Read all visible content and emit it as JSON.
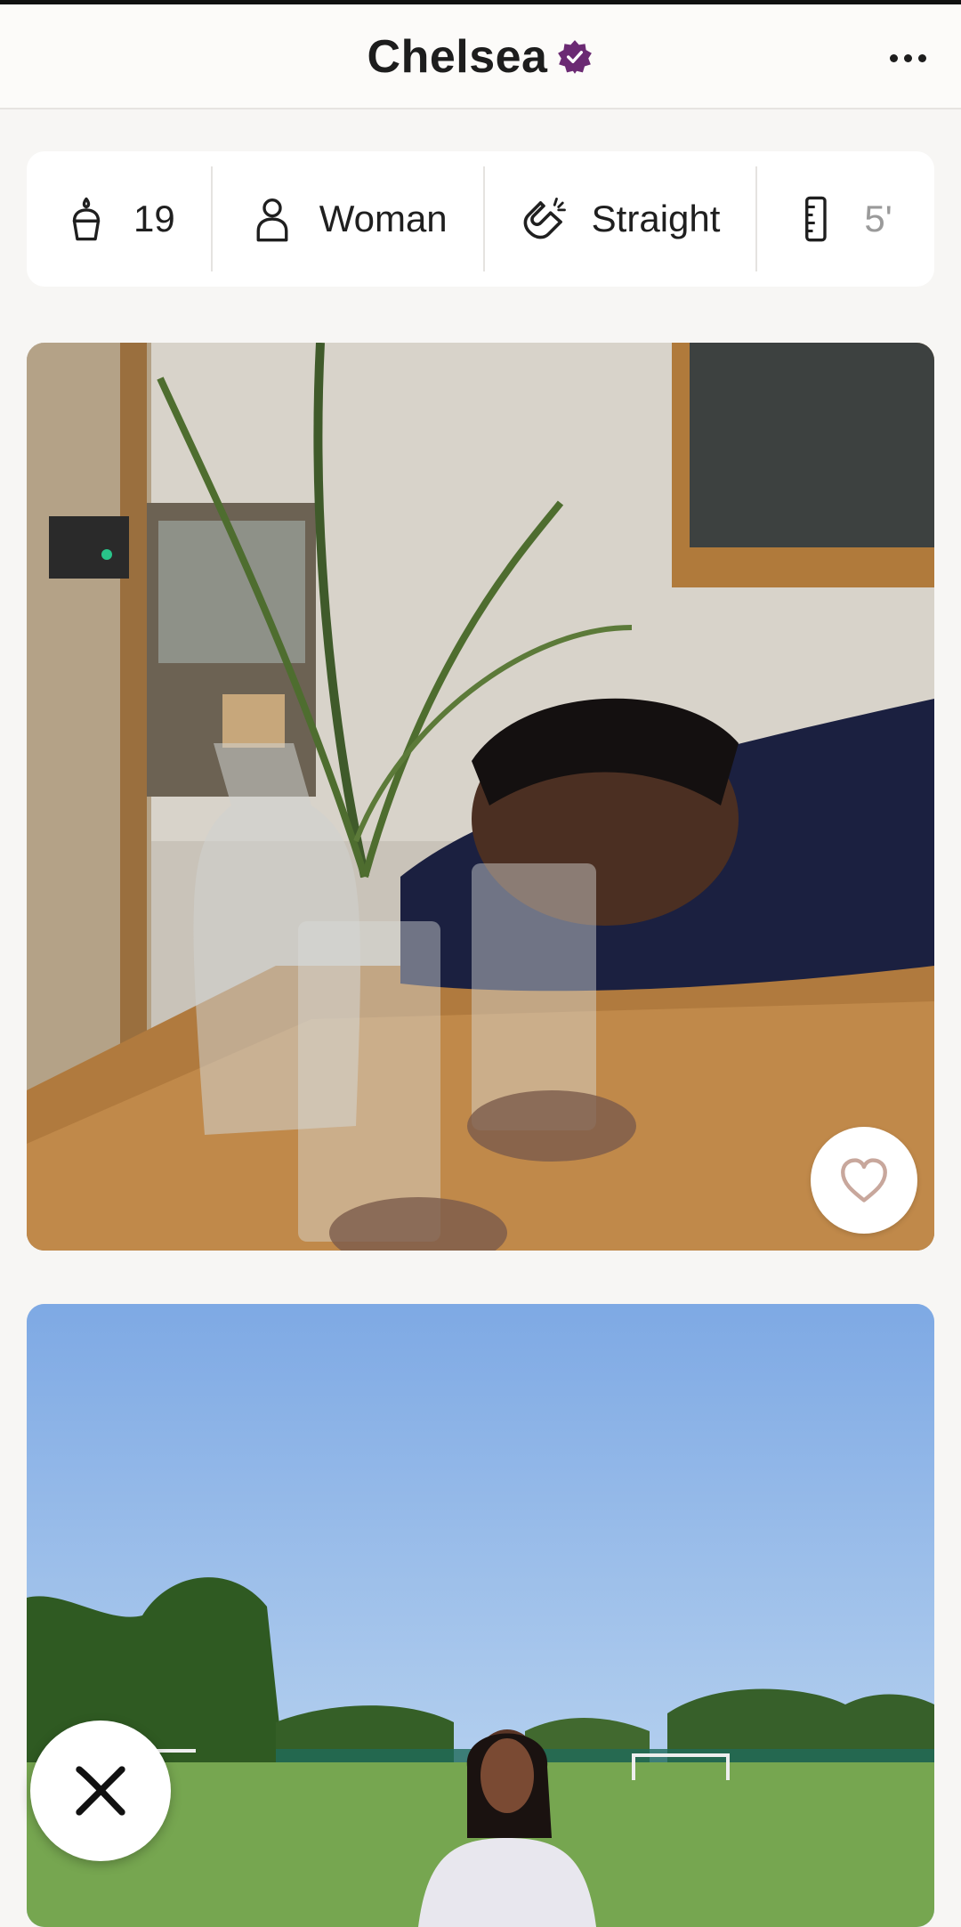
{
  "header": {
    "name": "Chelsea",
    "verified_icon": "verified-badge-icon",
    "more_icon": "more-options-icon"
  },
  "info": [
    {
      "icon": "birthday-cake-icon",
      "label": "19"
    },
    {
      "icon": "person-icon",
      "label": "Woman"
    },
    {
      "icon": "magnet-icon",
      "label": "Straight"
    },
    {
      "icon": "ruler-icon",
      "label": "5'"
    }
  ],
  "actions": {
    "like_icon": "heart-icon",
    "pass_icon": "close-icon"
  },
  "colors": {
    "accent_verified": "#6b2a73",
    "like_heart": "#c8a79c",
    "background": "#f7f6f4"
  }
}
